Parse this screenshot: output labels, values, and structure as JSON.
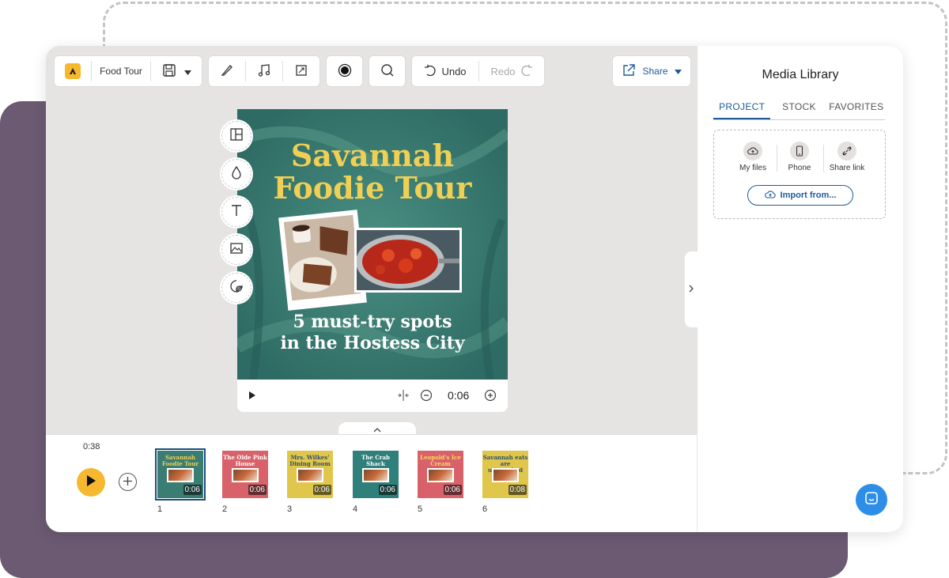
{
  "toolbar": {
    "project_name": "Food Tour",
    "undo_label": "Undo",
    "redo_label": "Redo",
    "share_label": "Share"
  },
  "canvas": {
    "title_line1": "Savannah",
    "title_line2": "Foodie Tour",
    "subtitle_line1": "5 must-try spots",
    "subtitle_line2": "in the Hostess City"
  },
  "player": {
    "time": "0:06"
  },
  "timeline": {
    "total_time": "0:38",
    "scenes": [
      {
        "number": "1",
        "title": "Savannah Foodie Tour",
        "duration": "0:06",
        "color": "#3a7d73",
        "text_color": "#f0cf55"
      },
      {
        "number": "2",
        "title": "The Olde Pink House",
        "duration": "0:06",
        "color": "#d9626a",
        "text_color": "#ffffff"
      },
      {
        "number": "3",
        "title": "Mrs. Wilkes' Dining Room",
        "duration": "0:06",
        "color": "#e0c64a",
        "text_color": "#2f4f6f"
      },
      {
        "number": "4",
        "title": "The Crab Shack",
        "duration": "0:06",
        "color": "#2f7f7a",
        "text_color": "#ffffff"
      },
      {
        "number": "5",
        "title": "Leopold's Ice Cream",
        "duration": "0:06",
        "color": "#d9626a",
        "text_color": "#f6d95a"
      },
      {
        "number": "6",
        "title": "Savannah eats are unmatched",
        "duration": "0:08",
        "color": "#e0c64a",
        "text_color": "#2f4f6f"
      }
    ]
  },
  "media_library": {
    "title": "Media Library",
    "tabs": [
      "PROJECT",
      "STOCK",
      "FAVORITES"
    ],
    "active_tab": "PROJECT",
    "sources": [
      "My files",
      "Phone",
      "Share link"
    ],
    "import_label": "Import from..."
  },
  "colors": {
    "accent": "#f5b82e",
    "primary_blue": "#1f5a9a",
    "chat_blue": "#2d8ee8",
    "backdrop_purple": "#6b5a72"
  }
}
